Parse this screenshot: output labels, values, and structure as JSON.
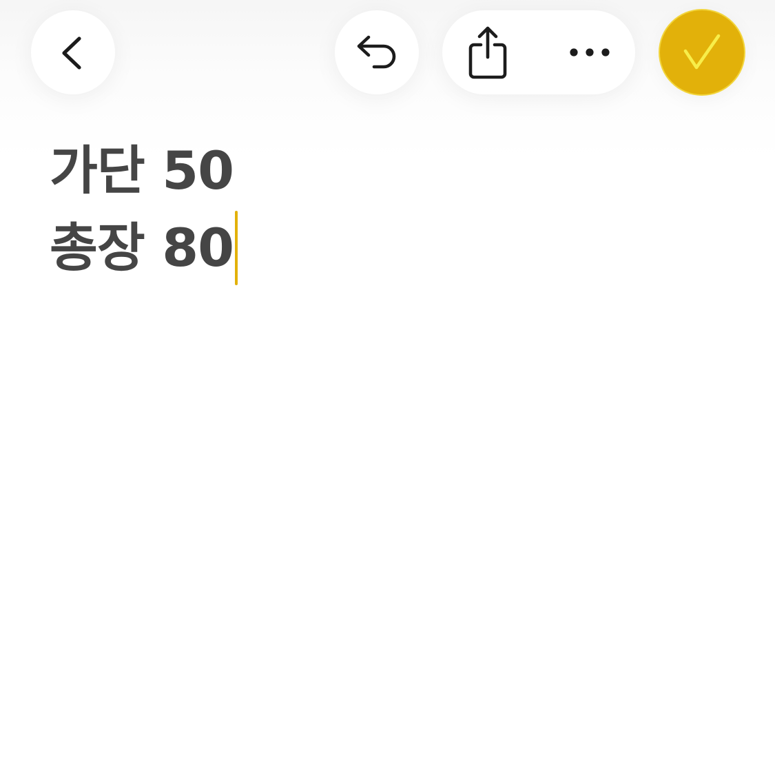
{
  "toolbar": {
    "back_icon": "chevron-left-icon",
    "undo_icon": "undo-icon",
    "share_icon": "share-icon",
    "more_icon": "ellipsis-icon",
    "done_icon": "checkmark-icon"
  },
  "note": {
    "lines": [
      "가단 50",
      "총장 80"
    ]
  },
  "colors": {
    "accent": "#e2b10a",
    "checkmark": "#f8ee4a",
    "text": "#454545",
    "icon": "#1c1c1c"
  }
}
